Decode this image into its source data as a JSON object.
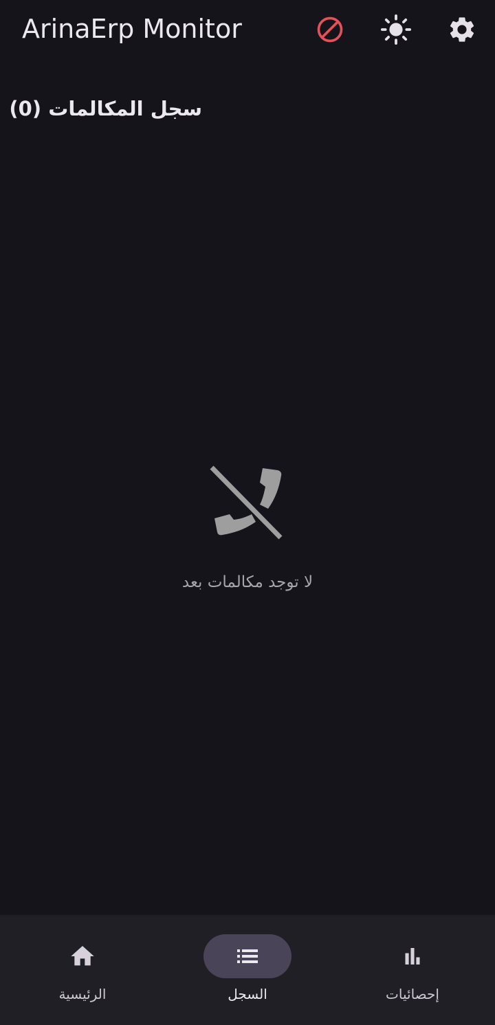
{
  "app": {
    "title": "ArinaErp Monitor"
  },
  "toolbar": {
    "actions": [
      {
        "icon": "block-icon",
        "color": "#e3515a"
      },
      {
        "icon": "sun-icon",
        "color": "#e6e1e9"
      },
      {
        "icon": "gear-icon",
        "color": "#e6e1e9"
      }
    ]
  },
  "log": {
    "title": "سجل المكالمات (0)",
    "empty_icon": "phone-disabled-icon",
    "empty_message": "لا توجد مكالمات بعد"
  },
  "nav": {
    "items": [
      {
        "label": "إحصائيات",
        "icon": "bar-chart-icon",
        "active": false
      },
      {
        "label": "السجل",
        "icon": "list-icon",
        "active": true
      },
      {
        "label": "الرئيسية",
        "icon": "home-icon",
        "active": false
      }
    ]
  },
  "colors": {
    "background": "#16141b",
    "nav_background": "#211f26",
    "active_indicator": "#4a4458",
    "accent_red": "#e3515a",
    "muted_text": "#a9a5ad"
  }
}
